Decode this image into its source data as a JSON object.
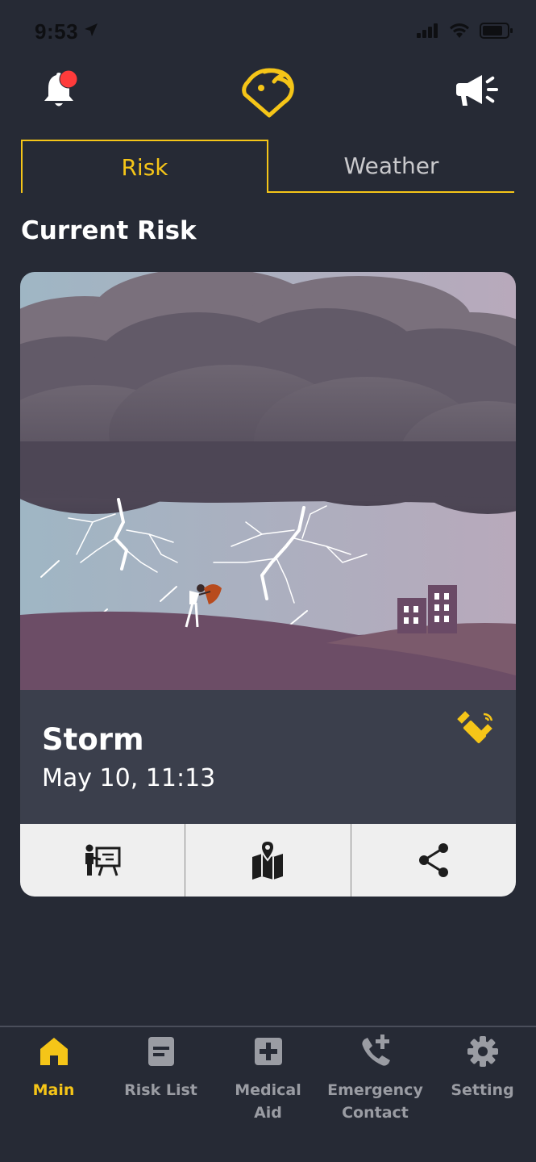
{
  "status_bar": {
    "time": "9:53"
  },
  "header": {
    "left_icon": "bell-icon",
    "center_icon": "logo-icon",
    "right_icon": "megaphone-icon",
    "notification_badge_color": "#ff3b3b"
  },
  "tabs": [
    {
      "label": "Risk",
      "active": true
    },
    {
      "label": "Weather",
      "active": false
    }
  ],
  "section_title": "Current Risk",
  "risk_card": {
    "image": "storm-illustration",
    "name": "Storm",
    "datetime": "May 10, 11:13",
    "source_icon": "satellite-icon",
    "actions": [
      {
        "icon": "presentation-icon"
      },
      {
        "icon": "map-icon"
      },
      {
        "icon": "share-icon"
      }
    ]
  },
  "bottom_nav": [
    {
      "label": "Main",
      "icon": "home-icon",
      "active": true
    },
    {
      "label": "Risk List",
      "icon": "list-icon",
      "active": false
    },
    {
      "label": "Medical\nAid",
      "icon": "medical-icon",
      "active": false
    },
    {
      "label": "Emergency\nContact",
      "icon": "phone-add-icon",
      "active": false
    },
    {
      "label": "Setting",
      "icon": "gear-icon",
      "active": false
    }
  ],
  "colors": {
    "background": "#262a35",
    "accent": "#f5c518",
    "card": "#3b3f4c",
    "action_bar": "#efefef",
    "inactive": "#9a9ca3"
  }
}
